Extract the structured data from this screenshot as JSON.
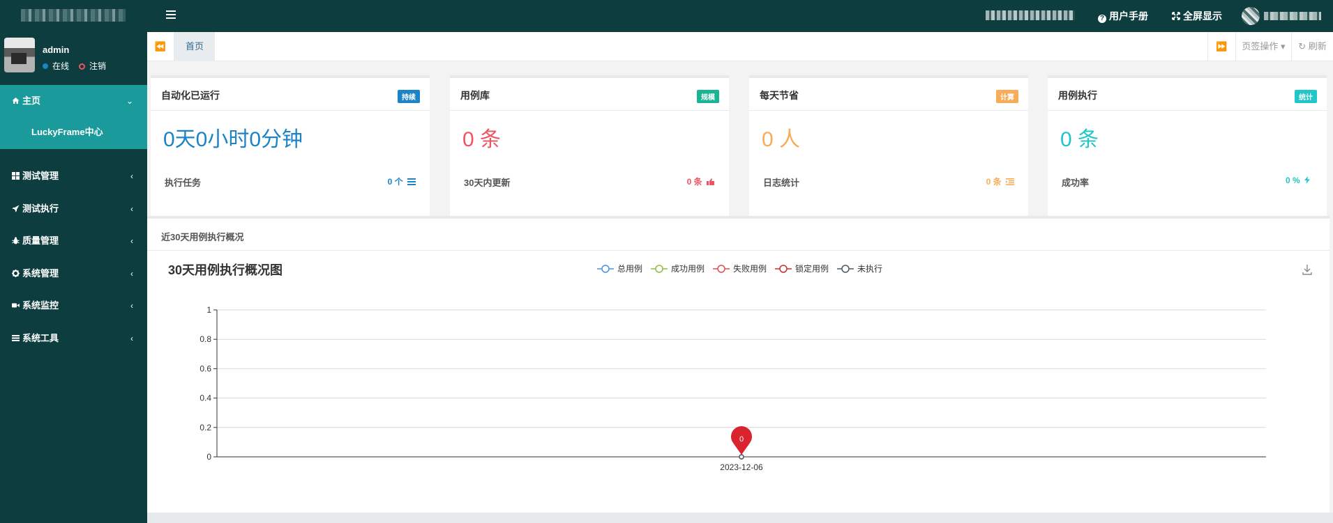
{
  "topbar": {
    "menu_icon": "hamburger-icon",
    "user_manual_label": "用户手册",
    "fullscreen_label": "全屏显示"
  },
  "sidebar": {
    "username": "admin",
    "status_label": "在线",
    "logout_label": "注销",
    "home": {
      "label": "主页",
      "icon": "home-icon",
      "sub_item": "LuckyFrame中心"
    },
    "items": [
      {
        "label": "测试管理",
        "icon": "grid-icon"
      },
      {
        "label": "测试执行",
        "icon": "rocket-icon"
      },
      {
        "label": "质量管理",
        "icon": "bug-icon"
      },
      {
        "label": "系统管理",
        "icon": "gear-icon"
      },
      {
        "label": "系统监控",
        "icon": "video-icon"
      },
      {
        "label": "系统工具",
        "icon": "list-icon"
      }
    ]
  },
  "tabs": {
    "active": "首页",
    "page_ops": "页签操作",
    "refresh": "刷新"
  },
  "colors": {
    "blue": "#1c84c6",
    "green": "#1ab394",
    "orange": "#f8ac59",
    "red": "#ed5565",
    "teal": "#23c6c8",
    "dark": "#0d3d3f"
  },
  "stats": [
    {
      "title": "自动化已运行",
      "badge": "持续",
      "value": "0天0小时0分钟",
      "sub_label": "执行任务",
      "sub_value": "0 个",
      "sub_icon": "list-icon",
      "color": "#1c84c6",
      "badge_color": "#1c84c6"
    },
    {
      "title": "用例库",
      "badge": "规模",
      "value": "0 条",
      "sub_label": "30天内更新",
      "sub_value": "0 条",
      "sub_icon": "thumbs-up-icon",
      "color": "#ed5565",
      "badge_color": "#1ab394"
    },
    {
      "title": "每天节省",
      "badge": "计算",
      "value": "0 人",
      "sub_label": "日志统计",
      "sub_value": "0 条",
      "sub_icon": "indent-icon",
      "color": "#f8ac59",
      "badge_color": "#f8ac59"
    },
    {
      "title": "用例执行",
      "badge": "统计",
      "value": "0 条",
      "sub_label": "成功率",
      "sub_value": "0 %",
      "sub_icon": "bolt-icon",
      "color": "#23c6c8",
      "badge_color": "#23c6c8"
    }
  ],
  "panel": {
    "title": "近30天用例执行概况"
  },
  "chart_data": {
    "type": "line",
    "title": "30天用例执行概况图",
    "categories": [
      "2023-12-06"
    ],
    "series": [
      {
        "name": "总用例",
        "values": [
          0
        ],
        "color": "#4a90e2"
      },
      {
        "name": "成功用例",
        "values": [
          0
        ],
        "color": "#8fbf3f"
      },
      {
        "name": "失败用例",
        "values": [
          0
        ],
        "color": "#d9534f"
      },
      {
        "name": "锁定用例",
        "values": [
          0
        ],
        "color": "#c9302c"
      },
      {
        "name": "未执行",
        "values": [
          0
        ],
        "color": "#4b5a66"
      }
    ],
    "ylim": [
      0,
      1
    ],
    "yticks": [
      "0",
      "0.2",
      "0.4",
      "0.6",
      "0.8",
      "1"
    ],
    "markpoint": {
      "value": "0",
      "color": "#d9232e"
    },
    "legend_position": "top-center",
    "grid": true
  }
}
